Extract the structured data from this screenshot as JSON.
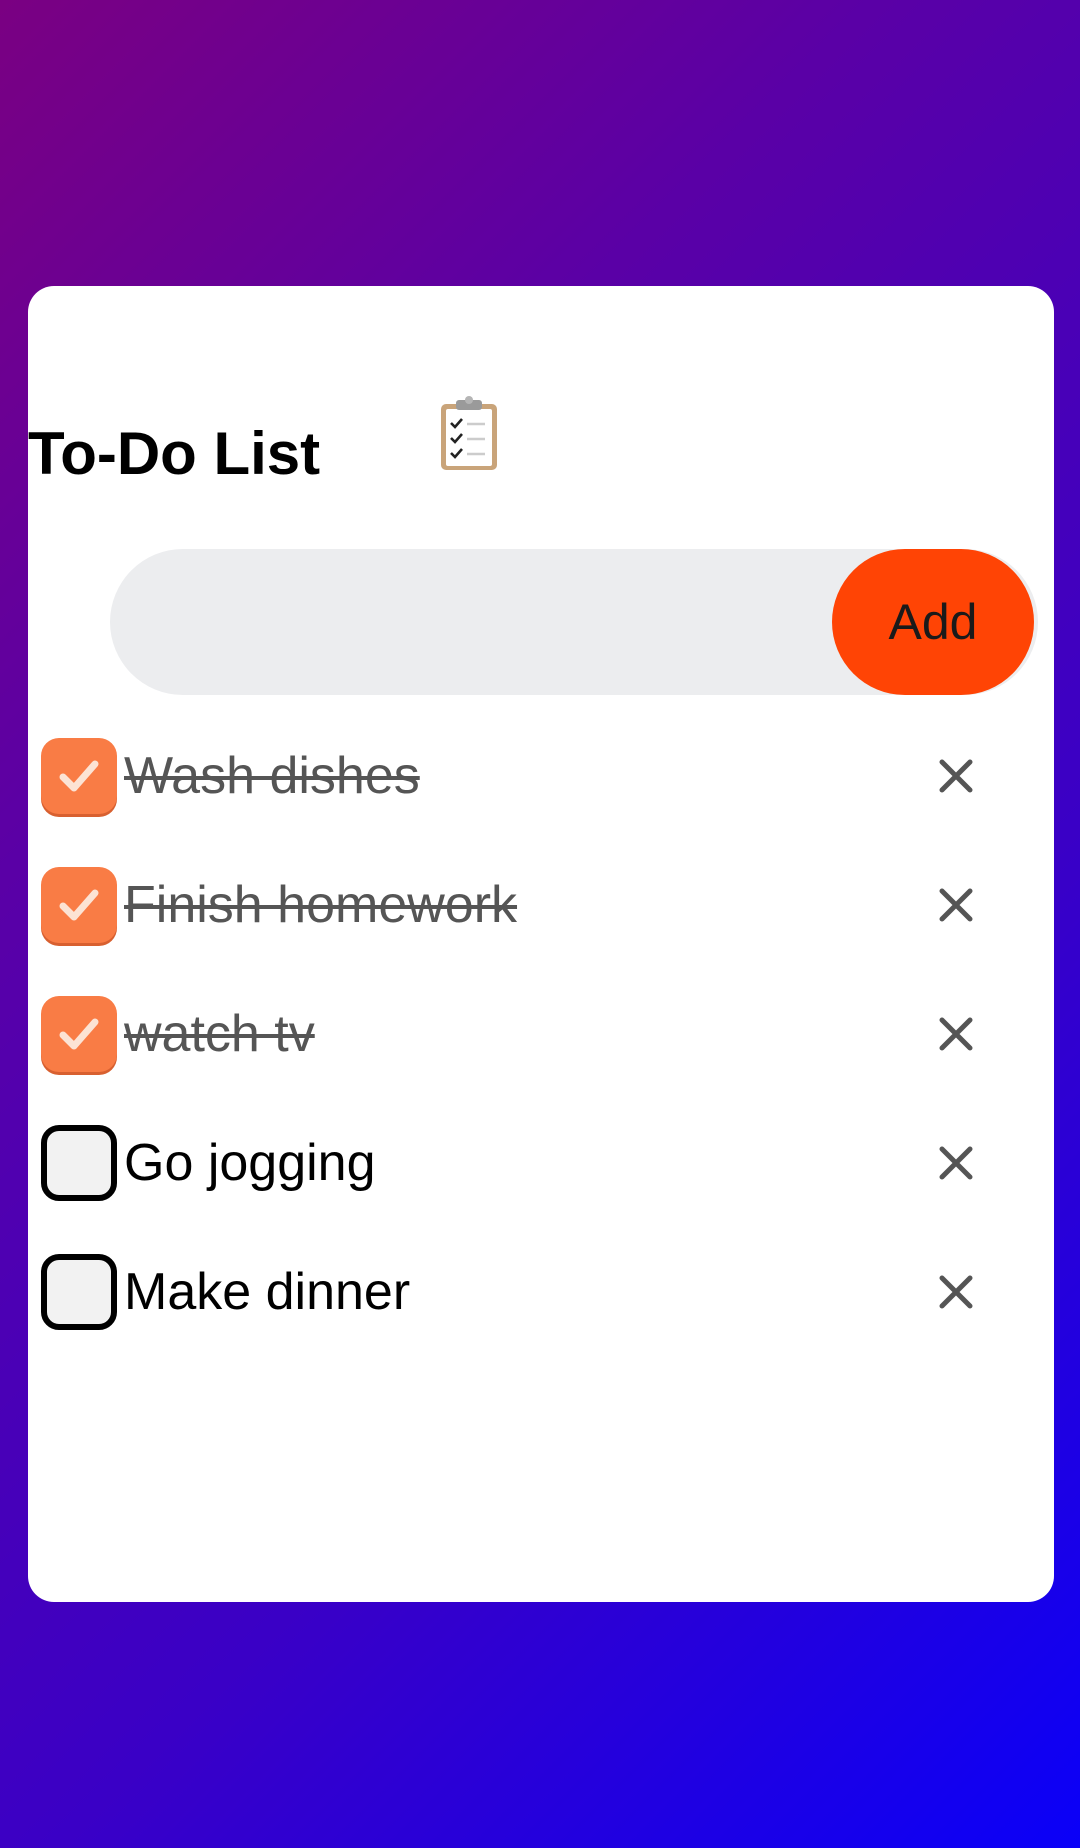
{
  "app": {
    "title": "To-Do List",
    "title_icon": "clipboard-checklist-icon"
  },
  "input": {
    "value": "",
    "placeholder": ""
  },
  "add_button": {
    "label": "Add",
    "color": "#ff4405"
  },
  "colors": {
    "checked_box": "#f97c45",
    "completed_text": "#555555",
    "delete_icon": "#555555"
  },
  "tasks": [
    {
      "text": "Wash dishes",
      "completed": true
    },
    {
      "text": "Finish homework",
      "completed": true
    },
    {
      "text": "watch tv",
      "completed": true
    },
    {
      "text": "Go jogging",
      "completed": false
    },
    {
      "text": "Make dinner",
      "completed": false
    }
  ]
}
